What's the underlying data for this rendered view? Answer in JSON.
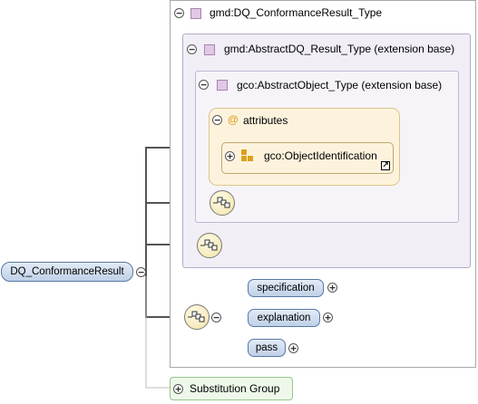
{
  "root_element": {
    "label": "DQ_ConformanceResult"
  },
  "conformance_type": {
    "label": "gmd:DQ_ConformanceResult_Type"
  },
  "abstract_result_type": {
    "label": "gmd:AbstractDQ_Result_Type (extension base)"
  },
  "abstract_object_type": {
    "label": "gco:AbstractObject_Type (extension base)"
  },
  "attributes": {
    "label": "attributes",
    "at_symbol": "@",
    "object_identification": {
      "label": "gco:ObjectIdentification",
      "link_glyph": "↗"
    }
  },
  "sequence_elements": [
    {
      "label": "specification"
    },
    {
      "label": "explanation"
    },
    {
      "label": "pass"
    }
  ],
  "substitution_group": {
    "label": "Substitution Group"
  },
  "toggles": {
    "collapse": "−",
    "expand": "+"
  },
  "colors": {
    "element_border": "#5877a6",
    "attribute_fill": "#fdf3dd",
    "type_icon": "#e2c8e6",
    "substitution_fill": "#eef8ea"
  }
}
